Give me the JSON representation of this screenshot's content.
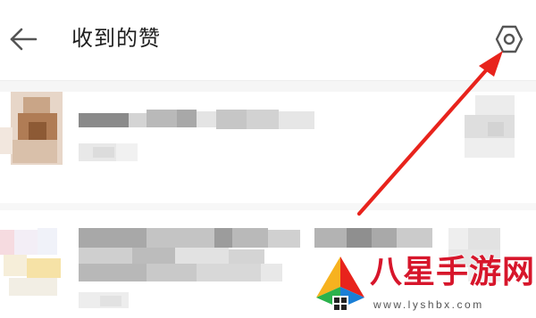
{
  "header": {
    "title": "收到的赞",
    "back_icon": "arrow-left-icon",
    "settings_icon": "hexagon-settings-icon"
  },
  "list": {
    "items": [
      {
        "content": "blurred"
      },
      {
        "content": "blurred"
      }
    ]
  },
  "annotation": {
    "arrow_color": "#e8231c",
    "points_to": "settings"
  },
  "watermark": {
    "brand": "八星手游网",
    "url": "www.lyshbx.com",
    "brand_color": "#d7162b"
  },
  "colors": {
    "background": "#ffffff",
    "title_text": "#1e1e1e",
    "icon": "#555555",
    "divider": "#eeeeee",
    "arrow": "#e8231c"
  }
}
